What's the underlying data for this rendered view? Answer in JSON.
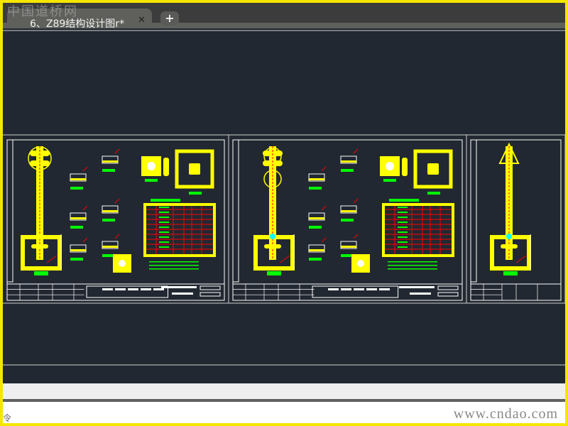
{
  "watermark": "中国道桥网",
  "tab": {
    "title": "6、Z89结构设计图r*",
    "close_icon": "close-icon",
    "add_icon": "plus-icon"
  },
  "drawing": {
    "sheets": 3,
    "colors": {
      "background": "#222831",
      "line": "#ffffff",
      "structure": "#ffff00",
      "label": "#00ff00",
      "rebar": "#ff0000",
      "accent": "#00ffff"
    }
  },
  "command_line": {
    "text": "令"
  },
  "footer_watermark": "www.cndao.com"
}
